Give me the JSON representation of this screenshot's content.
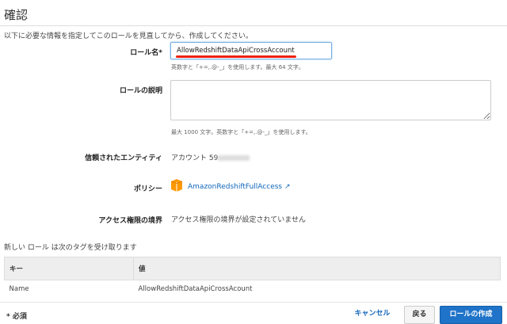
{
  "title": "確認",
  "intro": "以下に必要な情報を指定してこのロールを見直してから、作成してください。",
  "role_name": {
    "label": "ロール名*",
    "value": "AllowRedshiftDataApiCrossAccount",
    "hint": "英数字と「+=,.@-_」を使用します。最大 64 文字。"
  },
  "role_description": {
    "label": "ロールの説明",
    "value": "",
    "hint": "最大 1000 文字。英数字と「+=,.@-_」を使用します。"
  },
  "trusted_entity": {
    "label": "信頼されたエンティティ",
    "value": "アカウント 59"
  },
  "policy": {
    "label": "ポリシー",
    "link": "AmazonRedshiftFullAccess",
    "icon": "aws-box-icon"
  },
  "boundary": {
    "label": "アクセス権限の境界",
    "value": "アクセス権限の境界が設定されていません"
  },
  "tags": {
    "caption": "新しい ロール は次のタグを受け取ります",
    "headers": [
      "キー",
      "値"
    ],
    "rows": [
      {
        "key": "Name",
        "value": "AllowRedshiftDataApiCrossAcount"
      }
    ]
  },
  "footer": {
    "required": "* 必須",
    "cancel": "キャンセル",
    "back": "戻る",
    "create": "ロールの作成"
  }
}
